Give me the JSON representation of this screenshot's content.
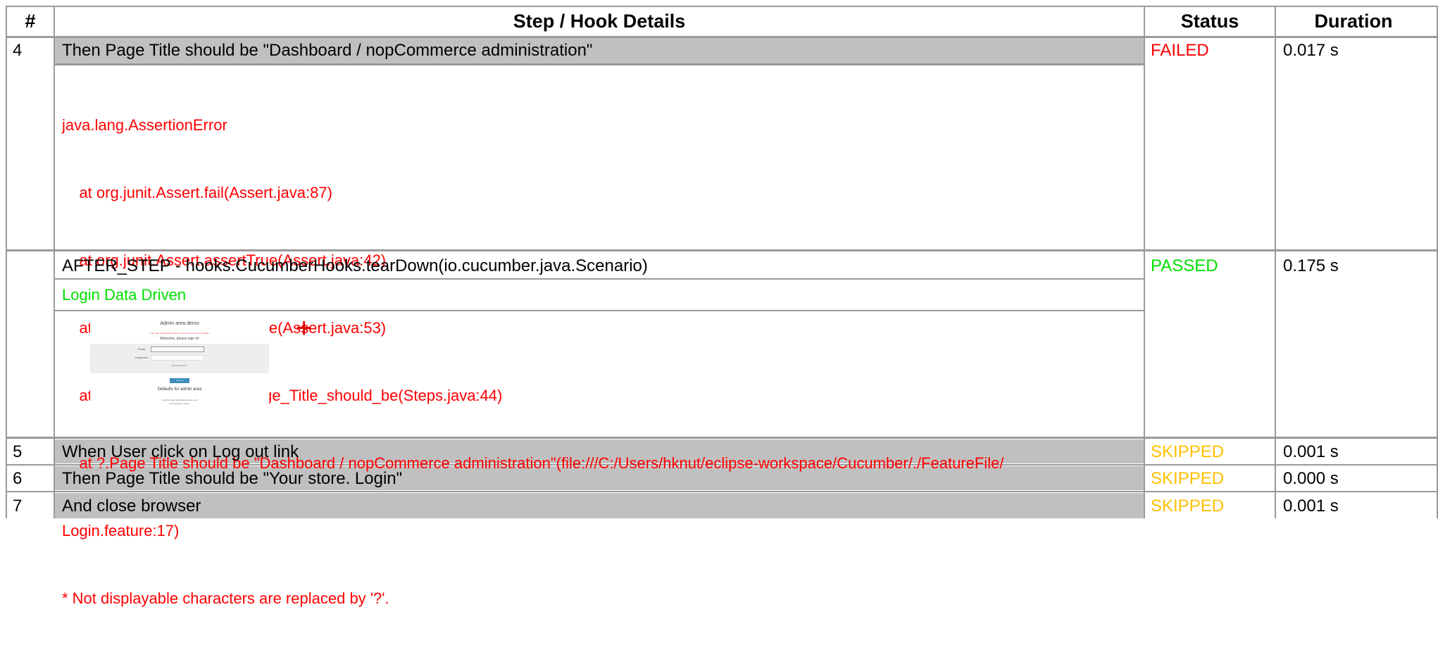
{
  "header": {
    "num": "#",
    "details": "Step / Hook Details",
    "status": "Status",
    "duration": "Duration"
  },
  "rows": [
    {
      "num": "4",
      "step": "Then Page Title should be \"Dashboard / nopCommerce administration\"",
      "status": "FAILED",
      "duration": "0.017 s",
      "trace": [
        "java.lang.AssertionError",
        "    at org.junit.Assert.fail(Assert.java:87)",
        "    at org.junit.Assert.assertTrue(Assert.java:42)",
        "    at org.junit.Assert.assertTrue(Assert.java:53)",
        "    at stepDefinitions.Steps.page_Title_should_be(Steps.java:44)",
        "    at ?.Page Title should be \"Dashboard / nopCommerce administration\"(file:///C:/Users/hknut/eclipse-workspace/Cucumber/./FeatureFile/",
        "Login.feature:17)",
        "* Not displayable characters are replaced by '?'."
      ]
    },
    {
      "num": "",
      "step": "AFTER_STEP - hooks.CucumberHooks.tearDown(io.cucumber.java.Scenario)",
      "status": "PASSED",
      "duration": "0.175 s",
      "embedding_name": "Login Data Driven",
      "embed_plus": "+",
      "thumb": {
        "title": "Admin area demo",
        "notice": "Login was unsuccessful. Please correct the errors and try again.",
        "welcome": "Welcome, please sign in!",
        "email_label": "Email:",
        "password_label": "Password:",
        "remember": "Remember me?",
        "button": "LOG IN",
        "defaults_title": "Defaults for admin area",
        "defaults_1": "Use this email: admin@yourstore.com",
        "defaults_2": "and password: admin"
      }
    },
    {
      "num": "5",
      "step": "When User click on Log out link",
      "status": "SKIPPED",
      "duration": "0.001 s"
    },
    {
      "num": "6",
      "step": "Then Page Title should be \"Your store. Login\"",
      "status": "SKIPPED",
      "duration": "0.000 s"
    },
    {
      "num": "7",
      "step": "And close browser",
      "status": "SKIPPED",
      "duration": "0.001 s"
    }
  ],
  "colors": {
    "failed": "#ff0000",
    "passed": "#00e000",
    "skipped": "#ffc000",
    "step_bg": "#c0c0c0",
    "border": "#9a9a9a"
  }
}
